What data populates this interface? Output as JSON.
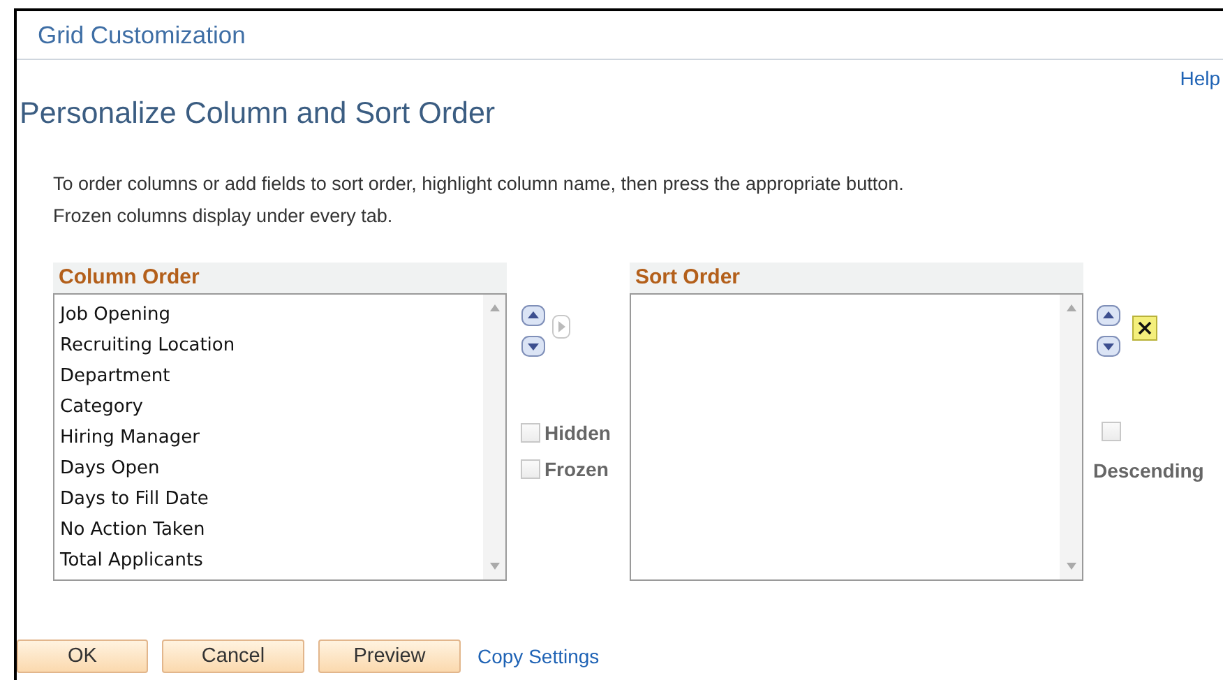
{
  "window": {
    "title": "Grid Customization"
  },
  "help_link": "Help",
  "heading": "Personalize Column and Sort Order",
  "instructions": [
    "To order columns or add fields to sort order, highlight column name, then press the appropriate button.",
    "Frozen columns display under every tab."
  ],
  "column_order": {
    "title": "Column Order",
    "items": [
      {
        "label": "Job Opening",
        "selected": false
      },
      {
        "label": "Recruiting Location",
        "selected": false
      },
      {
        "label": "Department",
        "selected": false
      },
      {
        "label": "Category",
        "selected": false
      },
      {
        "label": "Hiring Manager",
        "selected": false
      },
      {
        "label": "Days Open",
        "selected": false
      },
      {
        "label": "Days to Fill Date",
        "selected": false
      },
      {
        "label": "No Action Taken",
        "selected": false
      },
      {
        "label": "Total Applicants",
        "selected": false
      }
    ],
    "add_to_sort_disabled": true,
    "options": [
      {
        "label": "Hidden",
        "checked": false,
        "disabled": true
      },
      {
        "label": "Frozen",
        "checked": false,
        "disabled": true
      }
    ]
  },
  "sort_order": {
    "title": "Sort Order",
    "descending": {
      "label": "Descending",
      "checked": false,
      "disabled": true
    }
  },
  "buttons": [
    "OK",
    "Cancel",
    "Preview"
  ],
  "copy_link": "Copy Settings"
}
